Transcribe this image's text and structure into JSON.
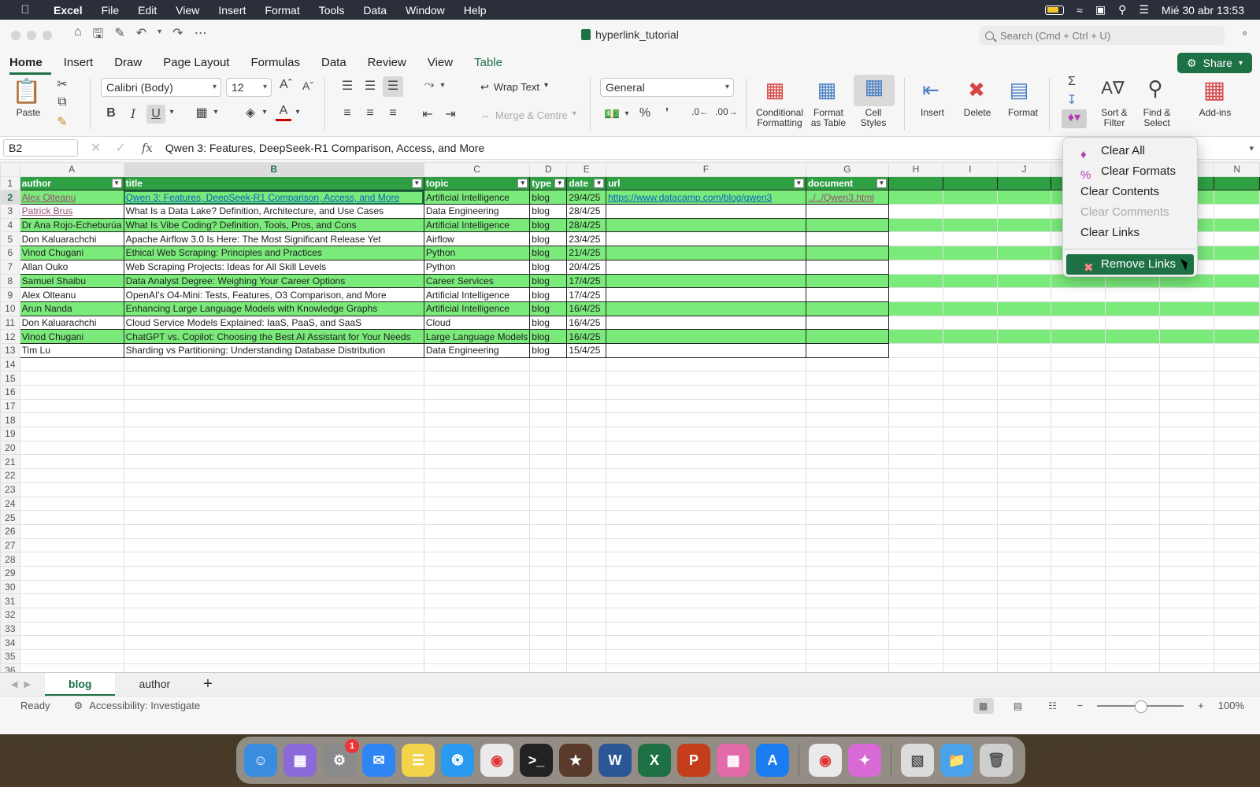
{
  "menubar": {
    "app": "Excel",
    "items": [
      "File",
      "Edit",
      "View",
      "Insert",
      "Format",
      "Tools",
      "Data",
      "Window",
      "Help"
    ],
    "datetime": "Mié 30 abr 13:53"
  },
  "window": {
    "doc_title": "hyperlink_tutorial",
    "search_placeholder": "Search (Cmd + Ctrl + U)"
  },
  "ribbon_tabs": [
    "Home",
    "Insert",
    "Draw",
    "Page Layout",
    "Formulas",
    "Data",
    "Review",
    "View",
    "Table"
  ],
  "share_label": "Share",
  "ribbon": {
    "paste": "Paste",
    "font_name": "Calibri (Body)",
    "font_size": "12",
    "wrap_text": "Wrap Text",
    "merge_centre": "Merge & Centre",
    "number_format": "General",
    "conditional_formatting": "Conditional Formatting",
    "format_as_table": "Format as Table",
    "cell_styles": "Cell Styles",
    "insert": "Insert",
    "delete": "Delete",
    "format": "Format",
    "sort_filter": "Sort & Filter",
    "find_select": "Find & Select",
    "add_ins": "Add-ins"
  },
  "formula_bar": {
    "name_box": "B2",
    "fx": "fx",
    "content": "Qwen 3: Features, DeepSeek-R1 Comparison, Access, and More"
  },
  "columns": [
    "A",
    "B",
    "C",
    "D",
    "E",
    "F",
    "G",
    "H",
    "I",
    "J",
    "K",
    "L",
    "M",
    "N"
  ],
  "header_row": [
    "author",
    "title",
    "topic",
    "type",
    "date",
    "url",
    "document"
  ],
  "rows": [
    [
      "Alex Olteanu",
      "Qwen 3: Features, DeepSeek-R1 Comparison, Access, and More",
      "Artificial Intelligence",
      "blog",
      "29/4/25",
      "https://www.datacamp.com/blog/qwen3",
      "../../Qwen3.html"
    ],
    [
      "Patrick Brus",
      "What Is a Data Lake? Definition, Architecture, and Use Cases",
      "Data Engineering",
      "blog",
      "28/4/25",
      "",
      ""
    ],
    [
      "Dr Ana Rojo-Echeburúa",
      "What Is Vibe Coding? Definition, Tools, Pros, and Cons",
      "Artificial Intelligence",
      "blog",
      "28/4/25",
      "",
      ""
    ],
    [
      "Don Kaluarachchi",
      "Apache Airflow 3.0 Is Here: The Most Significant Release Yet",
      "Airflow",
      "blog",
      "23/4/25",
      "",
      ""
    ],
    [
      "Vinod Chugani",
      "Ethical Web Scraping: Principles and Practices",
      "Python",
      "blog",
      "21/4/25",
      "",
      ""
    ],
    [
      "Allan Ouko",
      "Web Scraping Projects: Ideas for All Skill Levels",
      "Python",
      "blog",
      "20/4/25",
      "",
      ""
    ],
    [
      "Samuel Shaibu",
      "Data Analyst Degree: Weighing Your Career Options",
      "Career Services",
      "blog",
      "17/4/25",
      "",
      ""
    ],
    [
      "Alex Olteanu",
      "OpenAI's O4-Mini: Tests, Features, O3 Comparison, and More",
      "Artificial Intelligence",
      "blog",
      "17/4/25",
      "",
      ""
    ],
    [
      "Arun Nanda",
      "Enhancing Large Language Models with Knowledge Graphs",
      "Artificial Intelligence",
      "blog",
      "16/4/25",
      "",
      ""
    ],
    [
      "Don Kaluarachchi",
      "Cloud Service Models Explained: IaaS, PaaS, and SaaS",
      "Cloud",
      "blog",
      "16/4/25",
      "",
      ""
    ],
    [
      "Vinod Chugani",
      "ChatGPT vs. Copilot: Choosing the Best AI Assistant for Your Needs",
      "Large Language Models",
      "blog",
      "16/4/25",
      "",
      ""
    ],
    [
      "Tim Lu",
      "Sharding vs Partitioning: Understanding Database Distribution",
      "Data Engineering",
      "blog",
      "15/4/25",
      "",
      ""
    ]
  ],
  "clear_menu": {
    "items": [
      "Clear All",
      "Clear Formats",
      "Clear Contents",
      "Clear Comments",
      "Clear Links"
    ],
    "highlighted": "Remove Links"
  },
  "sheet_tabs": [
    "blog",
    "author"
  ],
  "status": {
    "ready": "Ready",
    "accessibility": "Accessibility: Investigate",
    "zoom": "100%"
  },
  "colors": {
    "accent": "#1e7145",
    "table_header": "#2ea043",
    "band": "#7aea7a"
  }
}
